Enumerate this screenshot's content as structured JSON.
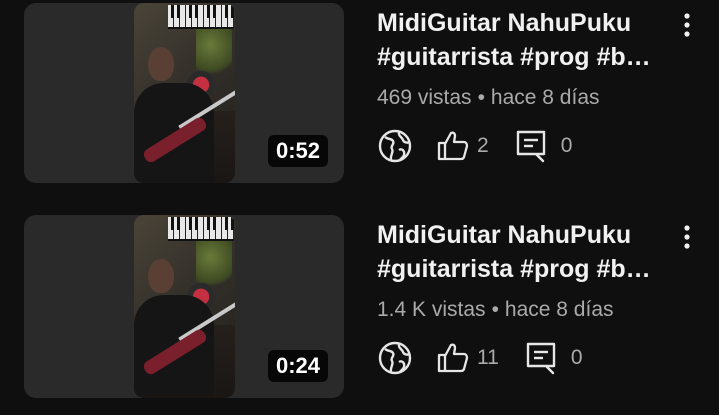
{
  "videos": [
    {
      "title_line1": "MidiGuitar NahuPuku",
      "title_line2": "#guitarrista #prog #b…",
      "duration": "0:52",
      "views": "469 vistas",
      "separator": "•",
      "age": "hace 8 días",
      "likes": "2",
      "comments": "0",
      "visibility_icon": "globe-icon",
      "like_icon": "thumbs-up-icon",
      "comment_icon": "comment-icon",
      "menu_icon": "more-vert-icon"
    },
    {
      "title_line1": "MidiGuitar NahuPuku",
      "title_line2": "#guitarrista #prog #b…",
      "duration": "0:24",
      "views": "1.4 K vistas",
      "separator": "•",
      "age": "hace 8 días",
      "likes": "11",
      "comments": "0",
      "visibility_icon": "globe-icon",
      "like_icon": "thumbs-up-icon",
      "comment_icon": "comment-icon",
      "menu_icon": "more-vert-icon"
    }
  ],
  "colors": {
    "background": "#0f0f0f",
    "text_primary": "#f1f1f1",
    "text_secondary": "#aaaaaa",
    "thumb_bg": "#2a2a2a"
  }
}
